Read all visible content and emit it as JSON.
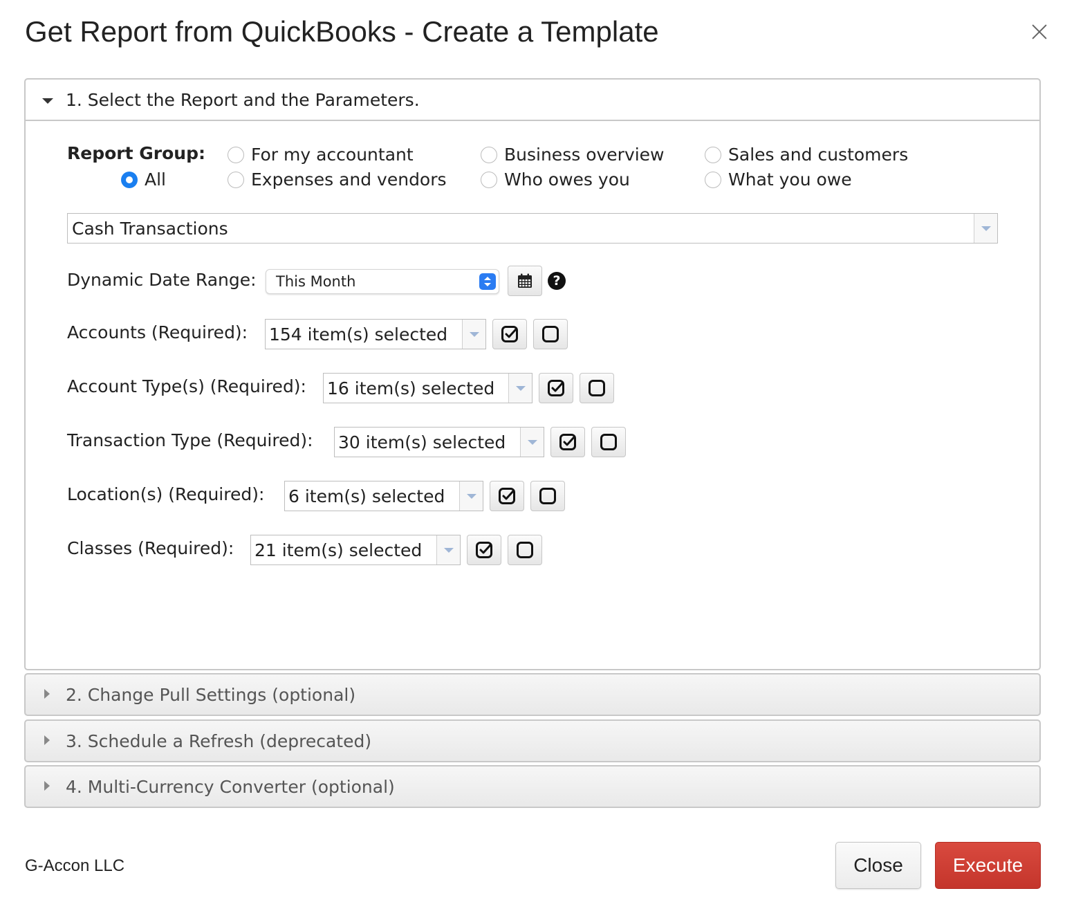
{
  "dialog": {
    "title": "Get Report from QuickBooks - Create a Template",
    "close_icon": "close-icon"
  },
  "section1": {
    "title": "1. Select the Report and the Parameters.",
    "report_group": {
      "label": "Report Group:",
      "options": [
        {
          "label": "All",
          "checked": true
        },
        {
          "label": "For my accountant",
          "checked": false
        },
        {
          "label": "Expenses and vendors",
          "checked": false
        },
        {
          "label": "Business overview",
          "checked": false
        },
        {
          "label": "Who owes you",
          "checked": false
        },
        {
          "label": "Sales and customers",
          "checked": false
        },
        {
          "label": "What you owe",
          "checked": false
        }
      ]
    },
    "report": {
      "value": "Cash Transactions"
    },
    "date_range": {
      "label": "Dynamic Date Range:",
      "value": "This Month",
      "help": "?"
    },
    "fields": [
      {
        "label": "Accounts (Required):",
        "value": "154 item(s) selected"
      },
      {
        "label": "Account Type(s) (Required):",
        "value": "16 item(s) selected"
      },
      {
        "label": "Transaction Type (Required):",
        "value": "30 item(s) selected"
      },
      {
        "label": "Location(s) (Required):",
        "value": "6 item(s) selected"
      },
      {
        "label": "Classes (Required):",
        "value": "21 item(s) selected"
      }
    ]
  },
  "sections": [
    {
      "title": "2. Change Pull Settings (optional)"
    },
    {
      "title": "3. Schedule a Refresh (deprecated)"
    },
    {
      "title": "4. Multi-Currency Converter (optional)"
    }
  ],
  "footer": {
    "brand": "G-Accon LLC",
    "close_label": "Close",
    "execute_label": "Execute"
  },
  "colors": {
    "accent": "#1a7ff0",
    "execute": "#d0433a"
  }
}
